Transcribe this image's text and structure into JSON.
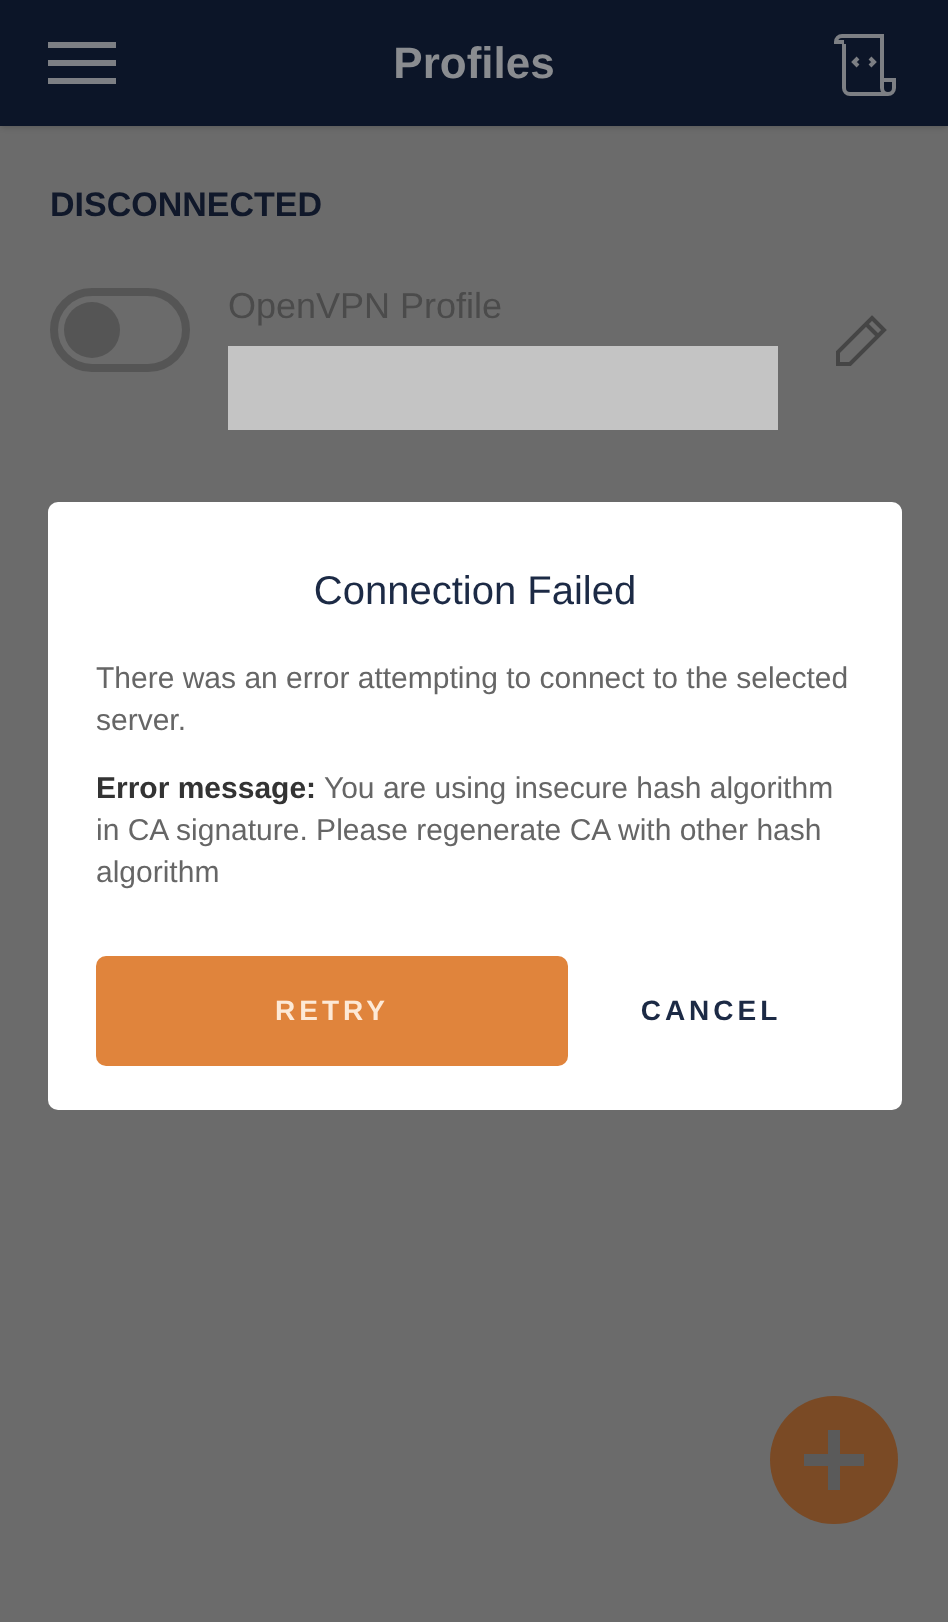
{
  "header": {
    "title": "Profiles"
  },
  "status": "DISCONNECTED",
  "profiles": [
    {
      "name": "OpenVPN Profile",
      "on": false
    }
  ],
  "dialog": {
    "title": "Connection Failed",
    "message": "There was an error attempting to connect to the selected server.",
    "error": "**Error message:** You are using insecure hash algorithm in CA signature. Please regenerate CA with other hash algorithm",
    "buttons": [
      {
        "label": "RETRY",
        "kind": "primary"
      },
      {
        "label": "CANCEL",
        "kind": "text"
      }
    ]
  }
}
